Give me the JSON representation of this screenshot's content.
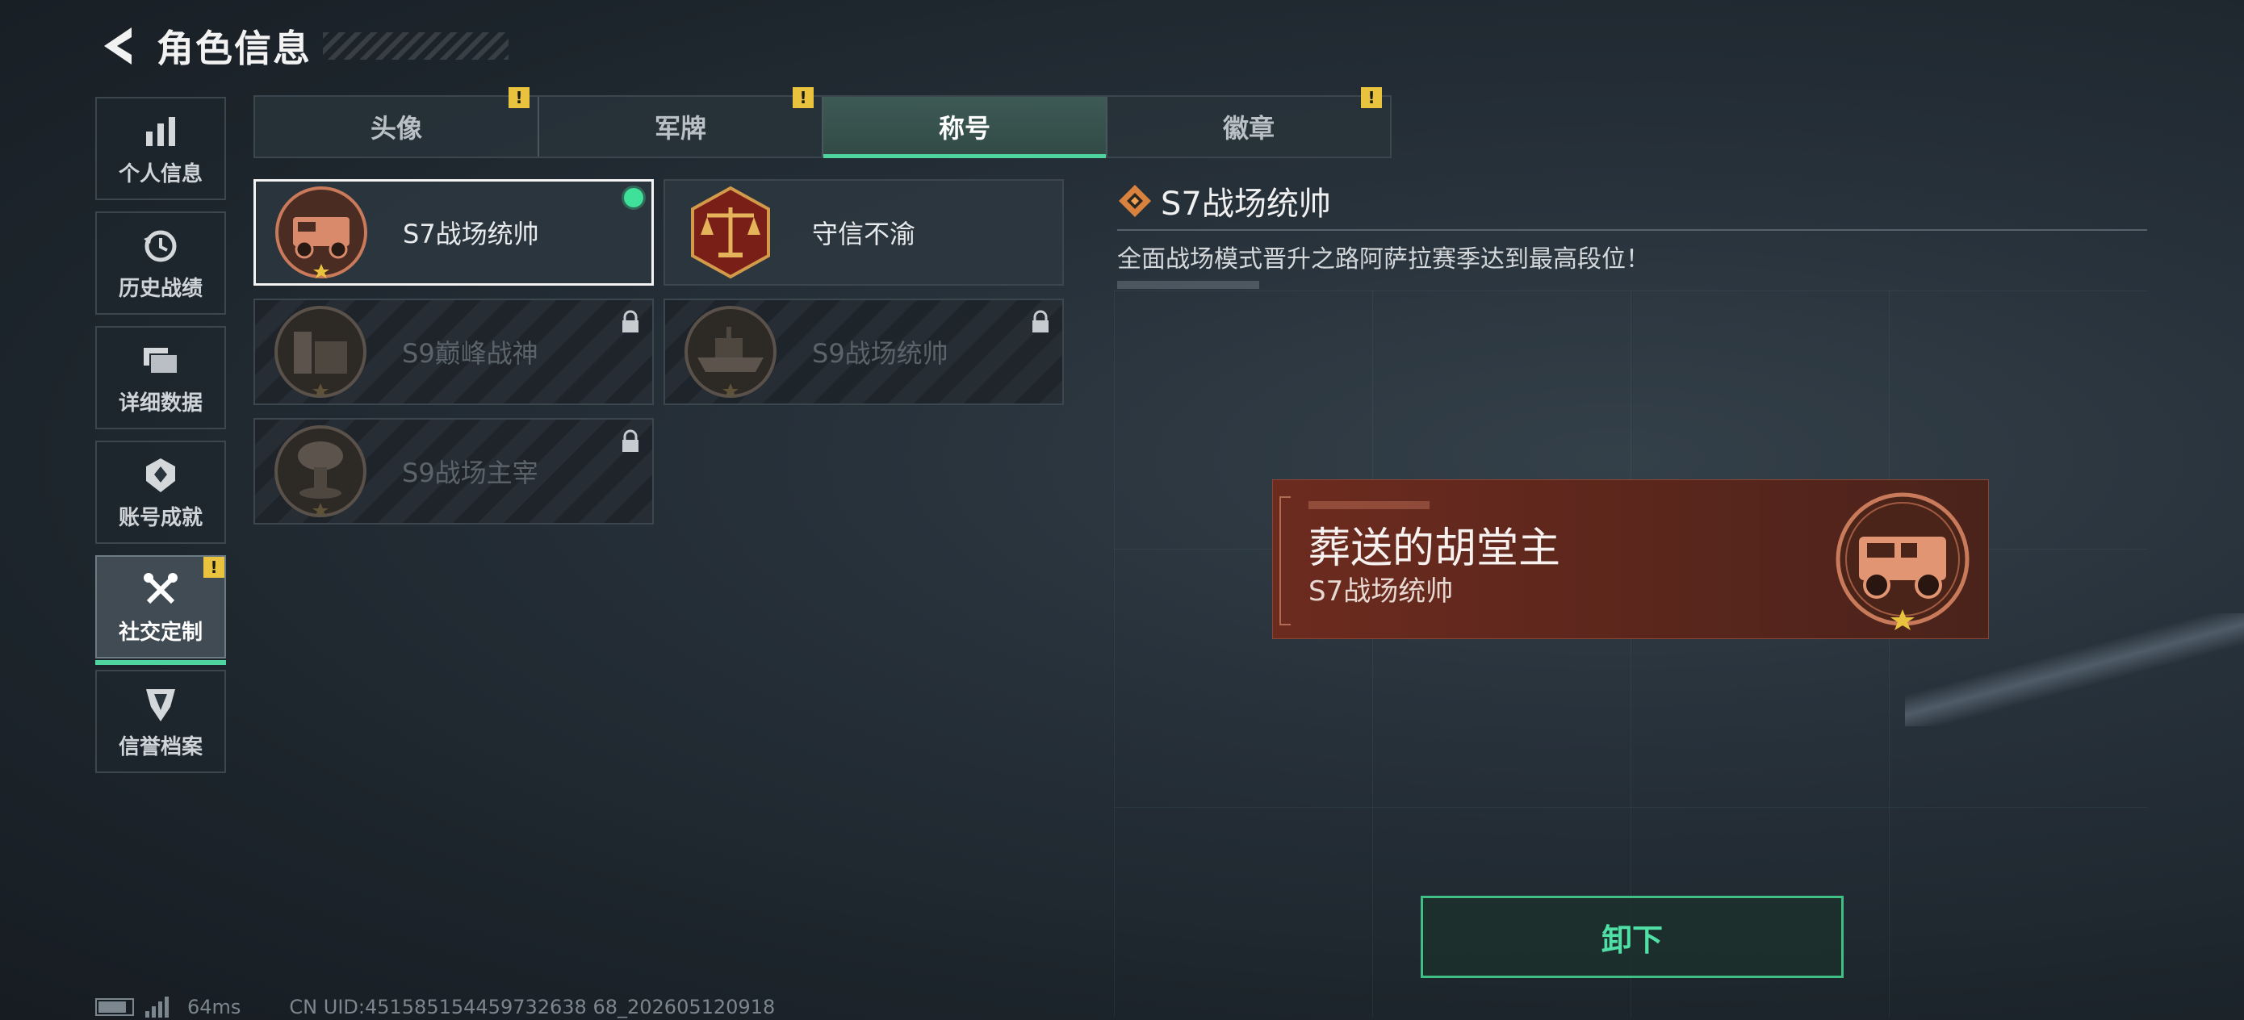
{
  "header": {
    "back_icon": "back-arrow-icon",
    "title": "角色信息"
  },
  "left_nav": {
    "items": [
      {
        "label": "个人信息",
        "icon": "bar-chart-icon",
        "active": false
      },
      {
        "label": "历史战绩",
        "icon": "history-clock-icon",
        "active": false
      },
      {
        "label": "详细数据",
        "icon": "folder-data-icon",
        "active": false
      },
      {
        "label": "账号成就",
        "icon": "achievement-medal-icon",
        "active": false
      },
      {
        "label": "社交定制",
        "icon": "wrench-screwdriver-icon",
        "active": true,
        "badge": "!"
      },
      {
        "label": "信誉档案",
        "icon": "reputation-shield-icon",
        "active": false
      }
    ]
  },
  "tabs": [
    {
      "label": "头像",
      "badge": "!",
      "active": false
    },
    {
      "label": "军牌",
      "badge": "!",
      "active": false
    },
    {
      "label": "称号",
      "badge": "",
      "active": true
    },
    {
      "label": "徽章",
      "badge": "!",
      "active": false
    }
  ],
  "titles": [
    {
      "name": "S7战场统帅",
      "emblem": "armored-truck-emblem-icon",
      "locked": false,
      "selected": true,
      "equipped": true
    },
    {
      "name": "守信不渝",
      "emblem": "scales-of-justice-emblem-icon",
      "locked": false,
      "selected": false,
      "equipped": false
    },
    {
      "name": "S9巅峰战神",
      "emblem": "fortress-emblem-icon",
      "locked": true,
      "selected": false,
      "equipped": false
    },
    {
      "name": "S9战场统帅",
      "emblem": "warship-emblem-icon",
      "locked": true,
      "selected": false,
      "equipped": false
    },
    {
      "name": "S9战场主宰",
      "emblem": "mushroom-cloud-emblem-icon",
      "locked": true,
      "selected": false,
      "equipped": false
    }
  ],
  "detail": {
    "icon": "diamond-rank-icon",
    "name": "S7战场统帅",
    "description": "全面战场模式晋升之路阿萨拉赛季达到最高段位！"
  },
  "preview": {
    "player_name": "葬送的胡堂主",
    "title": "S7战场统帅",
    "emblem": "armored-truck-emblem-icon"
  },
  "actions": {
    "unequip_label": "卸下"
  },
  "status_bar": {
    "battery_icon": "battery-icon",
    "signal_icon": "signal-icon",
    "ping": "64ms",
    "uid": "CN UID:451585154459732638 68_202605120918"
  },
  "colors": {
    "accent_green": "#4fd6a0",
    "badge_yellow": "#e9c33e",
    "emblem_copper": "#c97a5a",
    "preview_red": "#6d2b1f"
  }
}
